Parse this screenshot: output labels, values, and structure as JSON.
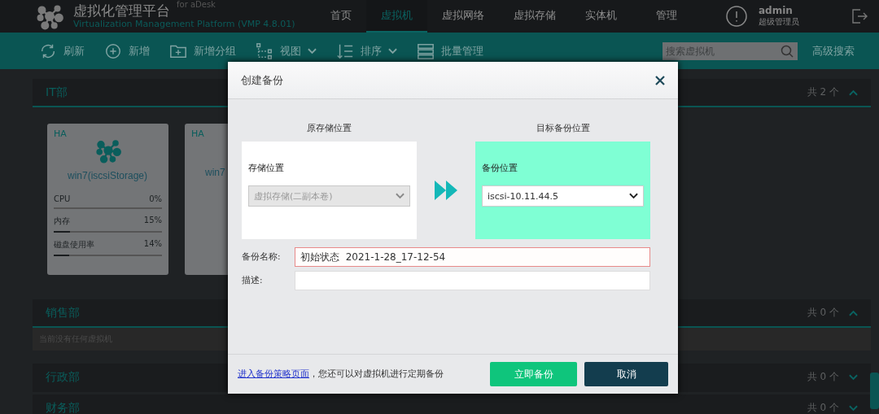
{
  "header": {
    "title": "虚拟化管理平台",
    "subtitle": "Virtualization Management Platform (VMP 4.8.01)",
    "edition": "for aDesk"
  },
  "nav": [
    {
      "label": "首页",
      "selected": false
    },
    {
      "label": "虚拟机",
      "selected": true
    },
    {
      "label": "虚拟网络",
      "selected": false
    },
    {
      "label": "虚拟存储",
      "selected": false
    },
    {
      "label": "实体机",
      "selected": false
    },
    {
      "label": "管理",
      "selected": false
    }
  ],
  "user": {
    "name": "admin",
    "role": "超级管理员"
  },
  "toolbar": {
    "actions": [
      {
        "label": "刷新",
        "kind": "refresh"
      },
      {
        "label": "新增",
        "kind": "add"
      },
      {
        "label": "新增分组",
        "kind": "add-group"
      },
      {
        "label": "视图",
        "kind": "view"
      },
      {
        "label": "排序",
        "kind": "sort"
      },
      {
        "label": "批量管理",
        "kind": "batch"
      }
    ],
    "search": {
      "placeholder": "搜索虚拟机"
    },
    "advanced_search": "高级搜索"
  },
  "groups": [
    {
      "name": "IT部",
      "count": "共 2 个",
      "expanded": true,
      "vms": [
        {
          "badge": "HA",
          "name": "win7(iscsiStorage)",
          "stats": [
            {
              "label": "CPU",
              "value": "0%",
              "level": 0
            },
            {
              "label": "内存",
              "value": "15%",
              "level": 0.15
            },
            {
              "label": "磁盘使用率",
              "value": "14%",
              "level": 0.14
            }
          ]
        },
        {
          "badge": "HA",
          "name": "win7"
        }
      ]
    },
    {
      "name": "销售部",
      "count": "共 0 个",
      "expanded": true,
      "empty_text": "当前没有任何虚拟机"
    },
    {
      "name": "行政部",
      "count": "共 0 个",
      "expanded": false
    },
    {
      "name": "财务部",
      "count": "共 0 个",
      "expanded": false
    }
  ],
  "dialog": {
    "title": "创建备份",
    "source": {
      "heading": "原存储位置",
      "label": "存储位置",
      "value": "虚拟存储(二副本卷)",
      "disabled": true
    },
    "target": {
      "heading": "目标备份位置",
      "label": "备份位置",
      "value": "iscsi-10.11.44.5",
      "disabled": false
    },
    "fields": [
      {
        "label": "备份名称:",
        "value": "初始状态  2021-1-28_17-12-54",
        "invalid": true
      },
      {
        "label": "描述:",
        "invalid": false
      }
    ],
    "footer": {
      "link": "进入备份策略页面",
      "text": "，您还可以对虚拟机进行定期备份"
    },
    "buttons": [
      {
        "label": "立即备份",
        "kind": "primary"
      },
      {
        "label": "取消",
        "kind": "secondary"
      }
    ]
  }
}
